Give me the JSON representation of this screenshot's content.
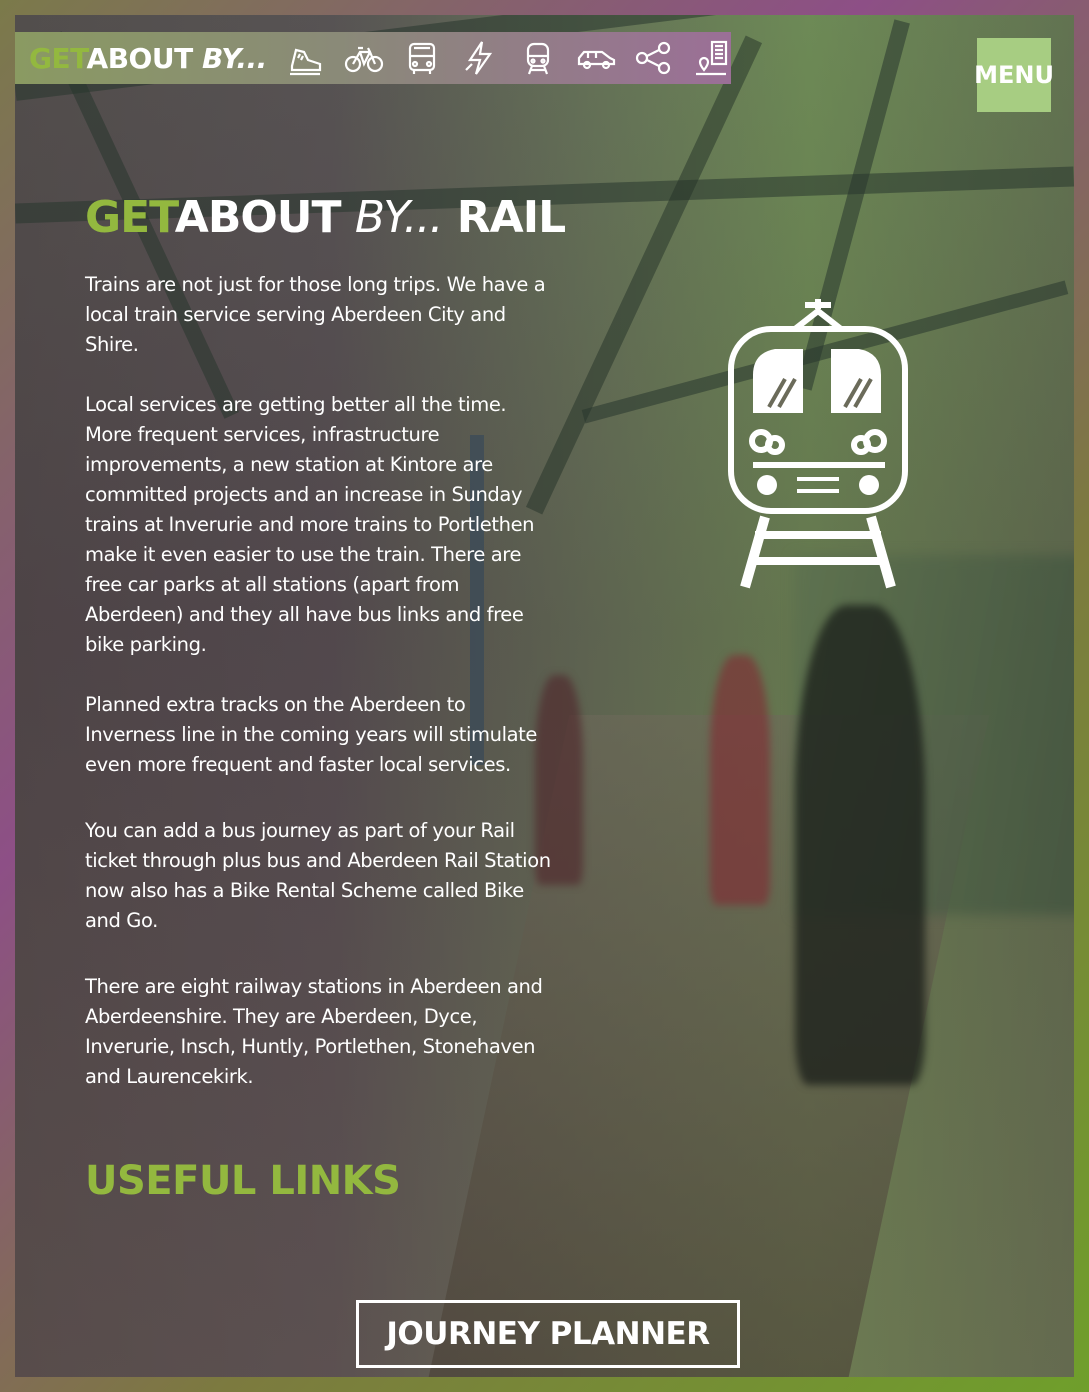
{
  "nav": {
    "brand_get": "GET",
    "brand_about": "ABOUT",
    "brand_by": "BY...",
    "icons": [
      {
        "name": "walking-shoe-icon"
      },
      {
        "name": "bicycle-icon"
      },
      {
        "name": "bus-icon"
      },
      {
        "name": "energy-icon"
      },
      {
        "name": "train-icon"
      },
      {
        "name": "car-icon"
      },
      {
        "name": "share-icon"
      },
      {
        "name": "building-location-icon"
      }
    ]
  },
  "menu": {
    "label": "MENU"
  },
  "heading": {
    "get": "GET",
    "about": "ABOUT",
    "by": "BY...",
    "mode": "RAIL"
  },
  "content": {
    "paragraphs": [
      "Trains are not just for those long trips. We have a local train service serving Aberdeen City and Shire.",
      "Local services are getting better all the time. More frequent services, infrastructure improvements, a new station at Kintore are committed projects and an increase in Sunday trains at Inverurie and more trains to Portlethen make it even easier to use the train. There are free car parks at all stations (apart from Aberdeen) and they all have bus links and free bike parking.",
      "Planned extra tracks on the Aberdeen to Inverness line in the coming years will stimulate even more frequent and faster local services.",
      "You can add a bus journey as part of your Rail ticket through plus bus and Aberdeen Rail Station now also has a Bike Rental Scheme called Bike and Go.",
      "There are eight railway stations in Aberdeen and Aberdeenshire. They are Aberdeen, Dyce, Inverurie, Insch, Huntly, Portlethen, Stonehaven and Laurencekirk."
    ]
  },
  "useful_links": {
    "title": "USEFUL LINKS"
  },
  "journey_planner": {
    "label": "JOURNEY PLANNER"
  },
  "colors": {
    "accent_green": "#93b83f",
    "menu_bg": "#a7cd82",
    "text": "#ffffff"
  }
}
